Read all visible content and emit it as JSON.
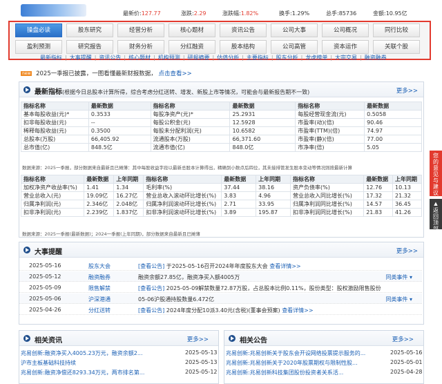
{
  "quote": {
    "latest_label": "最新价:",
    "latest_value": "127.77",
    "change_label": "涨跌:",
    "change_value": "2.29",
    "pct_label": "涨跌幅:",
    "pct_value": "1.82%",
    "turnover_label": "换手:",
    "turnover_value": "1.29%",
    "vol_label": "总手:",
    "vol_value": "85736",
    "amount_label": "金额:",
    "amount_value": "10.95亿"
  },
  "tabs_row1": [
    "操盘必读",
    "股东研究",
    "经营分析",
    "核心题材",
    "资讯公告",
    "公司大事",
    "公司概况",
    "同行比较"
  ],
  "tabs_row2": [
    "盈利预测",
    "研究报告",
    "财务分析",
    "分红融资",
    "股本结构",
    "公司高管",
    "资本运作",
    "关联个股"
  ],
  "subnav": [
    "最新指标",
    "大事提醒",
    "资讯公告",
    "核心题材",
    "机构预测",
    "研报摘要",
    "估值分析",
    "主要指标",
    "股东分析",
    "龙虎榜单",
    "大宗交易",
    "融资融券"
  ],
  "announce": {
    "badge": "new",
    "text": "2025一季报已披露，一图看懂最新财报数据，",
    "link": "点击查看>>"
  },
  "indicators": {
    "title": "最新指标",
    "subtitle": "(根据今日总股本计算所得，综合考虑分红送转、增发、新股上市等情况，可能会与最新报告期不一致)",
    "more": "更多>>",
    "headers": [
      "指标名称",
      "最新数据",
      "指标名称",
      "最新数据",
      "指标名称",
      "最新数据"
    ],
    "rows": [
      [
        "基本每股收益(元)*",
        "0.3533",
        "每股净资产(元)*",
        "25.2931",
        "每股经营现金流(元)",
        "0.5058"
      ],
      [
        "扣非每股收益(元)",
        "--",
        "每股公积金(元)",
        "12.5928",
        "市盈率(动)(倍)",
        "90.46"
      ],
      [
        "稀释每股收益(元)",
        "0.3500",
        "每股未分配利润(元)",
        "10.6582",
        "市盈率(TTM)(倍)",
        "74.97"
      ],
      [
        "总股本(万股)",
        "66,405.92",
        "流通股本(万股)",
        "66,371.60",
        "市盈率(静)(倍)",
        "77.00"
      ],
      [
        "总市值(亿)",
        "848.5亿",
        "流通市值(亿)",
        "848.0亿",
        "市净率(倍)",
        "5.05"
      ]
    ],
    "note1": "数据来源：2025一季报，部分数据来自最新且已摊薄：其中每股收益字段以最新总股本计算得出，精确到小数点后四位，其未接排管发生股本变动等情况则按最新计算",
    "headers2": [
      "指标名称",
      "最新数据",
      "上年同期",
      "指标名称",
      "最新数据",
      "上年同期",
      "指标名称",
      "最新数据",
      "上年同期"
    ],
    "rows2": [
      [
        "加权净资产收益率(%)",
        "1.41",
        "1.34",
        "毛利率(%)",
        "37.44",
        "38.16",
        "资产负债率(%)",
        "12.76",
        "10.13"
      ],
      [
        "营业总收入(元)",
        "19.09亿",
        "16.27亿",
        "营业总收入滚动环比增长(%)",
        "3.83",
        "4.96",
        "营业总收入同比增长(%)",
        "17.32",
        "21.32"
      ],
      [
        "归属净利润(元)",
        "2.346亿",
        "2.048亿",
        "归属净利润滚动环比增长(%)",
        "2.71",
        "33.95",
        "归属净利润同比增长(%)",
        "14.57",
        "36.45"
      ],
      [
        "扣非净利润(元)",
        "2.239亿",
        "1.837亿",
        "扣非净利润滚动环比增长(%)",
        "3.89",
        "195.87",
        "扣非净利润同比增长(%)",
        "21.83",
        "41.26"
      ]
    ],
    "note2": "数据来源：2025一季报(最新数据)；2024一季报(上年同期)，部分数据来自最新且已摊薄"
  },
  "events": {
    "title": "大事提醒",
    "more": "更多>>",
    "rows": [
      {
        "date": "2025-05-16",
        "type": "股东大会",
        "pre": "",
        "link": "[查看公告]",
        "text": "于2025-05-16召开2024年年度股东大会",
        "detail": "查看详情>>",
        "extra": ""
      },
      {
        "date": "2025-05-12",
        "type": "融资融券",
        "pre": "融资余额27.85亿，融资净买入额4005万",
        "link": "",
        "text": "",
        "detail": "",
        "extra": "同类事件"
      },
      {
        "date": "2025-05-09",
        "type": "限售解禁",
        "pre": "",
        "link": "[查看公告]",
        "text": "2025-05-09解禁数量72.87万股，占总股本比例0.11%，股份类型：股权激励限售股份",
        "detail": "",
        "extra": ""
      },
      {
        "date": "2025-05-06",
        "type": "沪深港通",
        "pre": "05-06沪股通持股数量6.472亿",
        "link": "",
        "text": "",
        "detail": "",
        "extra": "同类事件"
      },
      {
        "date": "2025-04-26",
        "type": "分红送转",
        "pre": "",
        "link": "[查看公告]",
        "text": "2024年度分配10派3.40元(含税)(董事会预案)",
        "detail": "查看详情>>",
        "extra": ""
      }
    ]
  },
  "news": {
    "title": "相关资讯",
    "more": "更多>>",
    "items": [
      {
        "title": "兆易创新:融资净买入4005.23万元，融资余额2...",
        "date": "2025-05-13"
      },
      {
        "title": "沪市主板基础科技持续",
        "date": "2025-05-13"
      },
      {
        "title": "兆易创新:融资净偿还8293.34万元，两市排名第...",
        "date": "2025-05-12"
      }
    ]
  },
  "notices": {
    "title": "相关公告",
    "more": "更多>>",
    "items": [
      {
        "title": "兆易创新:兆易创新关于股东会开设网络投票提示服务的...",
        "date": "2025-05-16"
      },
      {
        "title": "兆易创新:兆易创新关于2020年股票期权与限制性股...",
        "date": "2025-05-01"
      },
      {
        "title": "兆易创新:兆易创新科技集团股份投资者关系活...",
        "date": "2025-04-28"
      }
    ]
  },
  "side": {
    "feedback": "您的意见与建议",
    "top": "返回顶部"
  }
}
